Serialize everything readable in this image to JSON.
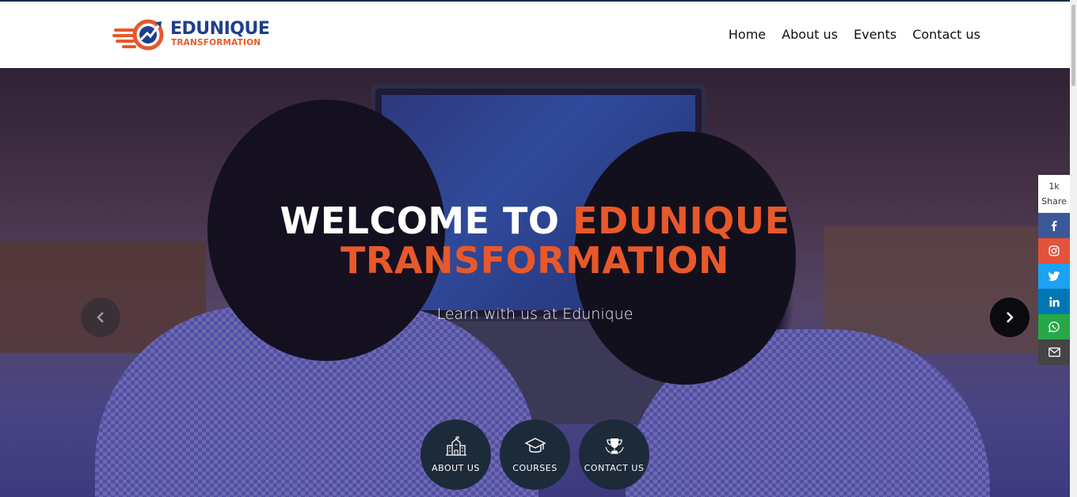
{
  "brand": {
    "name": "EDUNIQUE",
    "tagline": "TRANSFORMATION",
    "colors": {
      "navy": "#1f3e8c",
      "orange": "#e8582a"
    }
  },
  "nav": {
    "items": [
      {
        "label": "Home"
      },
      {
        "label": "About us"
      },
      {
        "label": "Events"
      },
      {
        "label": "Contact us"
      }
    ]
  },
  "hero": {
    "title_white": "WELCOME TO ",
    "title_orange_1": "EDUNIQUE",
    "title_orange_2": "TRANSFORMATION",
    "subtitle": "Learn with us at Edunique",
    "prev_icon": "chevron-left-icon",
    "next_icon": "chevron-right-icon"
  },
  "quick_links": [
    {
      "label": "ABOUT US",
      "icon": "school-building-icon"
    },
    {
      "label": "COURSES",
      "icon": "graduation-cap-icon"
    },
    {
      "label": "CONTACT US",
      "icon": "trophy-icon"
    }
  ],
  "share_bar": {
    "count": "1k",
    "label": "Share",
    "buttons": [
      {
        "network": "facebook",
        "icon": "facebook-icon",
        "color": "#3b5998"
      },
      {
        "network": "instagram",
        "icon": "instagram-icon",
        "color": "#e4513c"
      },
      {
        "network": "twitter",
        "icon": "twitter-icon",
        "color": "#1da1f2"
      },
      {
        "network": "linkedin",
        "icon": "linkedin-icon",
        "color": "#0077b5"
      },
      {
        "network": "whatsapp",
        "icon": "whatsapp-icon",
        "color": "#25a845"
      },
      {
        "network": "email",
        "icon": "envelope-icon",
        "color": "#444444"
      }
    ]
  }
}
